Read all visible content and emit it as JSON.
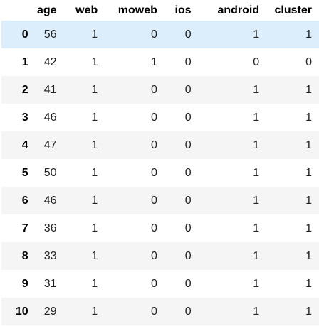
{
  "table": {
    "columns": [
      "",
      "age",
      "web",
      "moweb",
      "ios",
      "android",
      "cluster"
    ],
    "rows": [
      {
        "index": "0",
        "age": "56",
        "web": "1",
        "moweb": "0",
        "ios": "0",
        "android": "1",
        "cluster": "1"
      },
      {
        "index": "1",
        "age": "42",
        "web": "1",
        "moweb": "1",
        "ios": "0",
        "android": "0",
        "cluster": "0"
      },
      {
        "index": "2",
        "age": "41",
        "web": "1",
        "moweb": "0",
        "ios": "0",
        "android": "1",
        "cluster": "1"
      },
      {
        "index": "3",
        "age": "46",
        "web": "1",
        "moweb": "0",
        "ios": "0",
        "android": "1",
        "cluster": "1"
      },
      {
        "index": "4",
        "age": "47",
        "web": "1",
        "moweb": "0",
        "ios": "0",
        "android": "1",
        "cluster": "1"
      },
      {
        "index": "5",
        "age": "50",
        "web": "1",
        "moweb": "0",
        "ios": "0",
        "android": "1",
        "cluster": "1"
      },
      {
        "index": "6",
        "age": "46",
        "web": "1",
        "moweb": "0",
        "ios": "0",
        "android": "1",
        "cluster": "1"
      },
      {
        "index": "7",
        "age": "36",
        "web": "1",
        "moweb": "0",
        "ios": "0",
        "android": "1",
        "cluster": "1"
      },
      {
        "index": "8",
        "age": "33",
        "web": "1",
        "moweb": "0",
        "ios": "0",
        "android": "1",
        "cluster": "1"
      },
      {
        "index": "9",
        "age": "31",
        "web": "1",
        "moweb": "0",
        "ios": "0",
        "android": "1",
        "cluster": "1"
      },
      {
        "index": "10",
        "age": "29",
        "web": "1",
        "moweb": "0",
        "ios": "0",
        "android": "1",
        "cluster": "1"
      }
    ],
    "selected_row": 0
  },
  "colors": {
    "selected_row_bg": "#dceefb",
    "striped_row_bg": "#f5f5f5"
  }
}
